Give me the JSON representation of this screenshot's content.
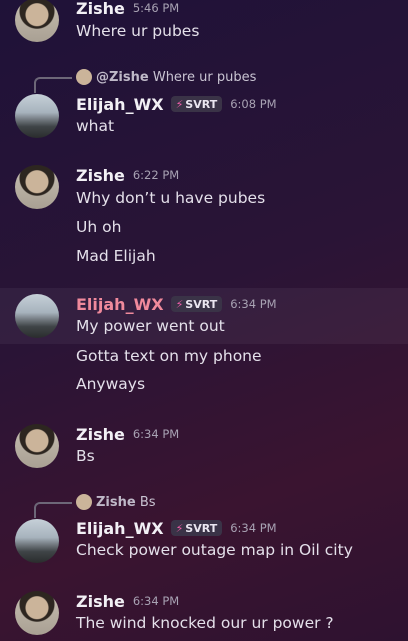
{
  "messages": [
    {
      "author": "Zishe",
      "time": "5:46 PM",
      "lines": [
        "Where ur pubes"
      ]
    },
    {
      "reply": {
        "name": "@Zishe",
        "text": "Where ur pubes"
      },
      "author": "Elijah_WX",
      "tag": "SVRT",
      "time": "6:08 PM",
      "lines": [
        "what"
      ]
    },
    {
      "author": "Zishe",
      "time": "6:22 PM",
      "lines": [
        "Why don’t u have pubes",
        "Uh oh",
        "Mad Elijah"
      ]
    },
    {
      "author": "Elijah_WX",
      "tag": "SVRT",
      "time": "6:34 PM",
      "lines": [
        "My power went out",
        "Gotta text on my phone",
        "Anyways"
      ]
    },
    {
      "author": "Zishe",
      "time": "6:34 PM",
      "lines": [
        "Bs"
      ]
    },
    {
      "reply": {
        "name": "Zishe",
        "text": "Bs"
      },
      "author": "Elijah_WX",
      "tag": "SVRT",
      "time": "6:34 PM",
      "lines": [
        "Check power outage map in Oil city"
      ]
    },
    {
      "author": "Zishe",
      "time": "6:34 PM",
      "lines": [
        "The wind knocked our ur power ?"
      ]
    }
  ],
  "colors": {
    "highlight_name": "#f08a9c",
    "tag_bolt": "#ef5da8"
  },
  "icons": {
    "tag": "lightning-bolt-icon"
  }
}
